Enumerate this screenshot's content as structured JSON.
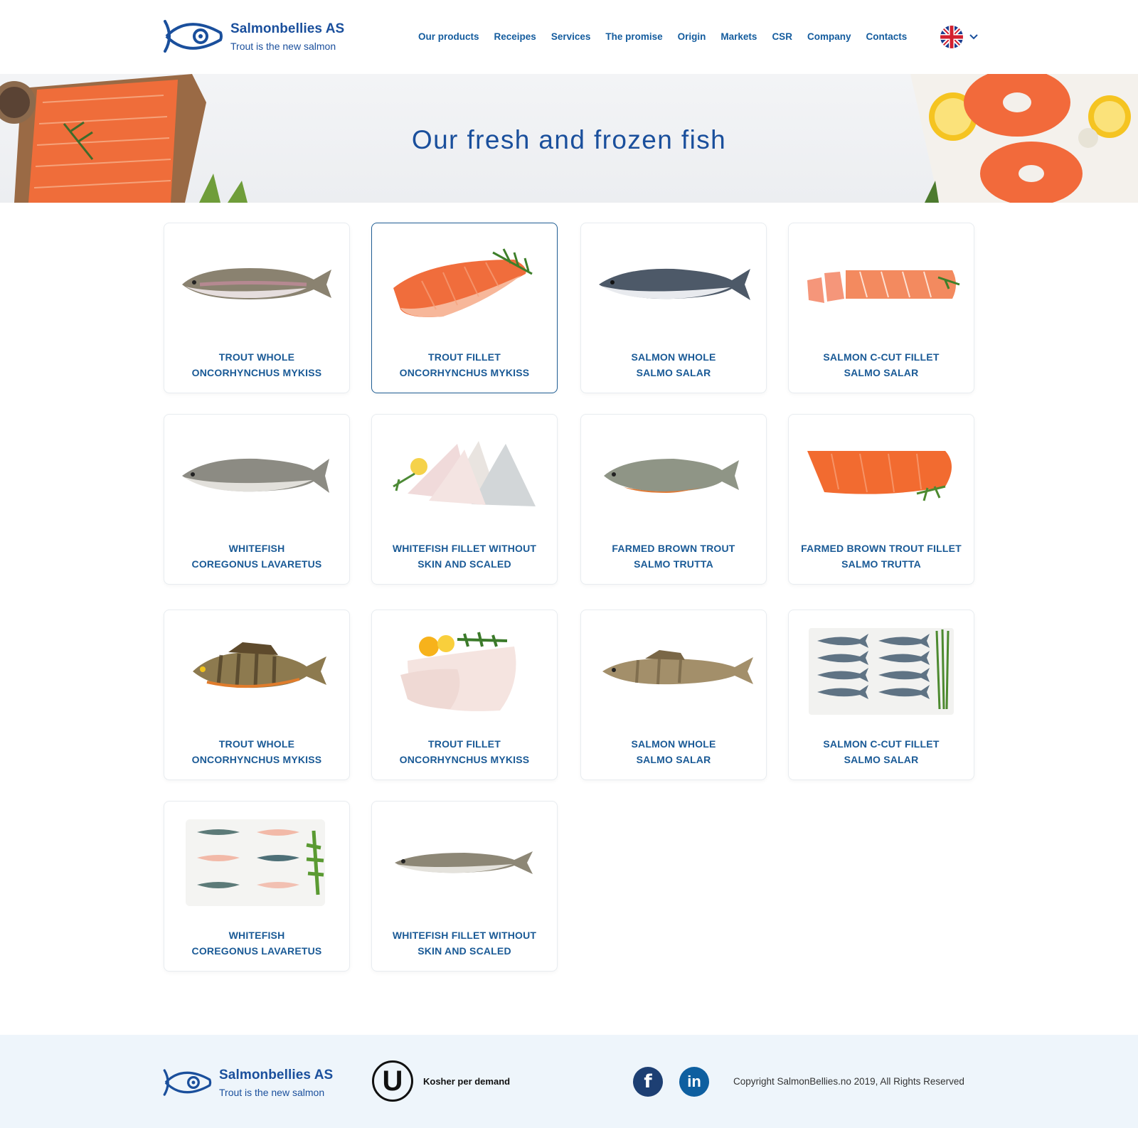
{
  "brand": {
    "name": "Salmonbellies AS",
    "tagline": "Trout is the new salmon",
    "color": "#1a4f9c"
  },
  "nav": {
    "items": [
      "Our products",
      "Receipes",
      "Services",
      "The promise",
      "Origin",
      "Markets",
      "CSR",
      "Company",
      "Contacts"
    ],
    "language_icon": "uk-flag-icon"
  },
  "hero": {
    "title": "Our fresh and frozen fish"
  },
  "products": [
    {
      "name": "TROUT WHOLE",
      "latin": "ONCORHYNCHUS MYKISS",
      "image": "trout-whole",
      "active": false
    },
    {
      "name": "TROUT FILLET",
      "latin": "ONCORHYNCHUS MYKISS",
      "image": "trout-fillet",
      "active": true
    },
    {
      "name": "SALMON WHOLE",
      "latin": "SALMO SALAR",
      "image": "salmon-whole",
      "active": false
    },
    {
      "name": "SALMON C-CUT FILLET",
      "latin": "SALMO SALAR",
      "image": "salmon-ccut",
      "active": false
    },
    {
      "name": "WHITEFISH",
      "latin": "COREGONUS LAVARETUS",
      "image": "whitefish",
      "active": false
    },
    {
      "name": "WHITEFISH FILLET WITHOUT",
      "latin": "SKIN AND SCALED",
      "image": "whitefish-fillet",
      "active": false
    },
    {
      "name": "FARMED BROWN TROUT",
      "latin": "SALMO TRUTTA",
      "image": "brown-trout",
      "active": false
    },
    {
      "name": "FARMED BROWN TROUT FILLET",
      "latin": "SALMO TRUTTA",
      "image": "brown-trout-fillet",
      "active": false
    },
    {
      "name": "TROUT WHOLE",
      "latin": "ONCORHYNCHUS MYKISS",
      "image": "perch",
      "active": false
    },
    {
      "name": "TROUT FILLET",
      "latin": "ONCORHYNCHUS MYKISS",
      "image": "white-fillet",
      "active": false
    },
    {
      "name": "SALMON WHOLE",
      "latin": "SALMO SALAR",
      "image": "pikeperch",
      "active": false
    },
    {
      "name": "SALMON C-CUT FILLET",
      "latin": "SALMO SALAR",
      "image": "herring-tray",
      "active": false
    },
    {
      "name": "WHITEFISH",
      "latin": "COREGONUS LAVARETUS",
      "image": "fillet-tray",
      "active": false
    },
    {
      "name": "WHITEFISH FILLET WITHOUT",
      "latin": "SKIN AND SCALED",
      "image": "vendace",
      "active": false
    }
  ],
  "footer": {
    "kosher_text": "Kosher per demand",
    "kosher_mark": "U",
    "facebook": "f",
    "linkedin": "in",
    "copyright": "Copyright SalmonBellies.no 2019, All Rights Reserved"
  }
}
